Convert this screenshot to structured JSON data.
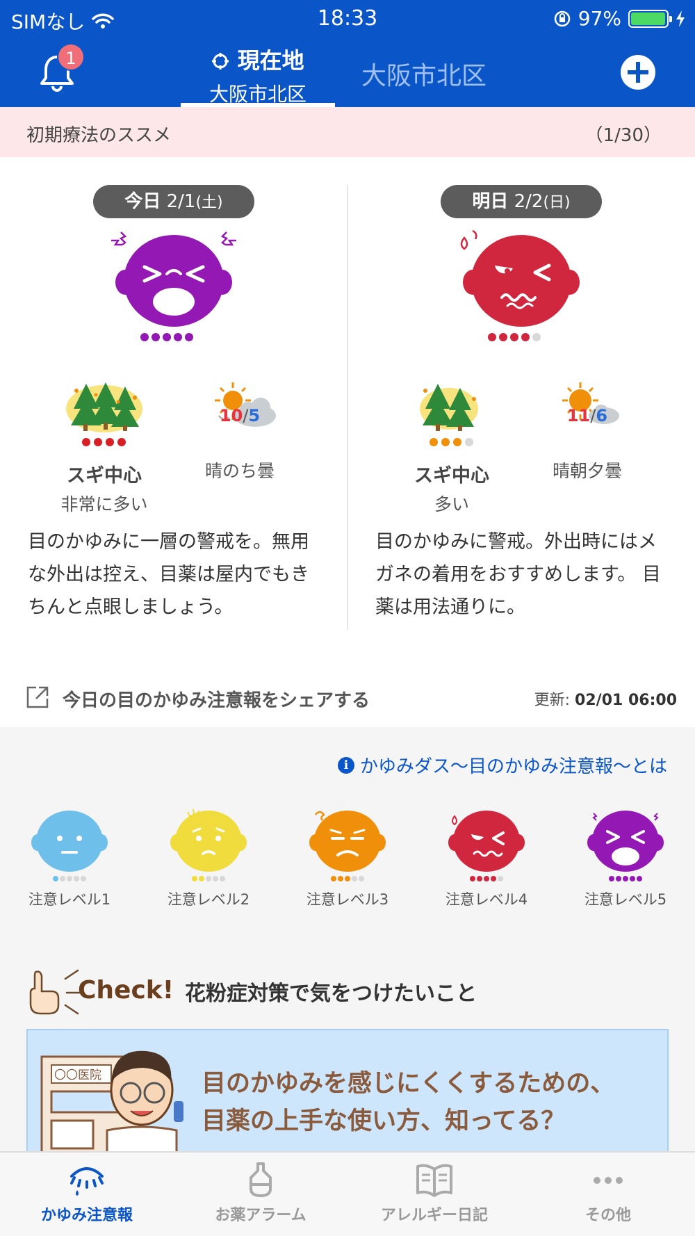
{
  "status_bar": {
    "carrier": "SIMなし",
    "time": "18:33",
    "battery_percent": "97%",
    "battery_level": 0.97
  },
  "header": {
    "notification_count": "1",
    "tabs": [
      {
        "icon": "current-location-icon",
        "title": "現在地",
        "subtitle": "大阪市北区",
        "active": true
      },
      {
        "title": "大阪市北区",
        "active": false
      }
    ]
  },
  "notice": {
    "text": "初期療法のススメ",
    "page": "（1/30）"
  },
  "forecast": {
    "today": {
      "day_label": "今日",
      "date": "2/1",
      "weekday": "(土)",
      "itch_level": 5,
      "pollen_dots": 4,
      "pollen_title": "スギ中心",
      "pollen_level_text": "非常に多い",
      "temp_high": "10",
      "temp_low": "5",
      "temp_sep": "/",
      "weather": "晴のち曇",
      "advice": "目のかゆみに一層の警戒を。無用な外出は控え、目薬は屋内でもきちんと点眼しましょう。"
    },
    "tomorrow": {
      "day_label": "明日",
      "date": "2/2",
      "weekday": "(日)",
      "itch_level": 4,
      "pollen_dots": 3,
      "pollen_title": "スギ中心",
      "pollen_level_text": "多い",
      "temp_high": "11",
      "temp_low": "6",
      "temp_sep": "/",
      "weather": "晴朝夕曇",
      "advice": "目のかゆみに警戒。外出時にはメガネの着用をおすすめします。 目薬は用法通りに。"
    }
  },
  "share": {
    "label": "今日の目のかゆみ注意報をシェアする",
    "update_label": "更新:",
    "update_time": "02/01 06:00"
  },
  "about_link": "かゆみダス〜目のかゆみ注意報〜とは",
  "levels": [
    {
      "label": "注意レベル1",
      "color": "#6ec0ea",
      "level": 1
    },
    {
      "label": "注意レベル2",
      "color": "#f0dc3c",
      "level": 2
    },
    {
      "label": "注意レベル3",
      "color": "#f0900a",
      "level": 3
    },
    {
      "label": "注意レベル4",
      "color": "#d0263e",
      "level": 4
    },
    {
      "label": "注意レベル5",
      "color": "#9418b4",
      "level": 5
    }
  ],
  "check": {
    "badge": "Check!",
    "title": "花粉症対策で気をつけたいこと"
  },
  "banner": {
    "clinic_sign": "〇〇医院",
    "line1": "目のかゆみを感じにくくするための、",
    "line2": "目薬の上手な使い方、知ってる？"
  },
  "bottom_nav": [
    {
      "label": "かゆみ注意報",
      "icon": "eye-itch-icon",
      "active": true
    },
    {
      "label": "お薬アラーム",
      "icon": "medicine-bottle-icon",
      "active": false
    },
    {
      "label": "アレルギー日記",
      "icon": "book-icon",
      "active": false
    },
    {
      "label": "その他",
      "icon": "more-icon",
      "active": false
    }
  ],
  "colors": {
    "brand_blue": "#0a56c8",
    "notice_bg": "#fde7e8",
    "level5_purple": "#9418b4",
    "level4_red": "#d0263e"
  }
}
